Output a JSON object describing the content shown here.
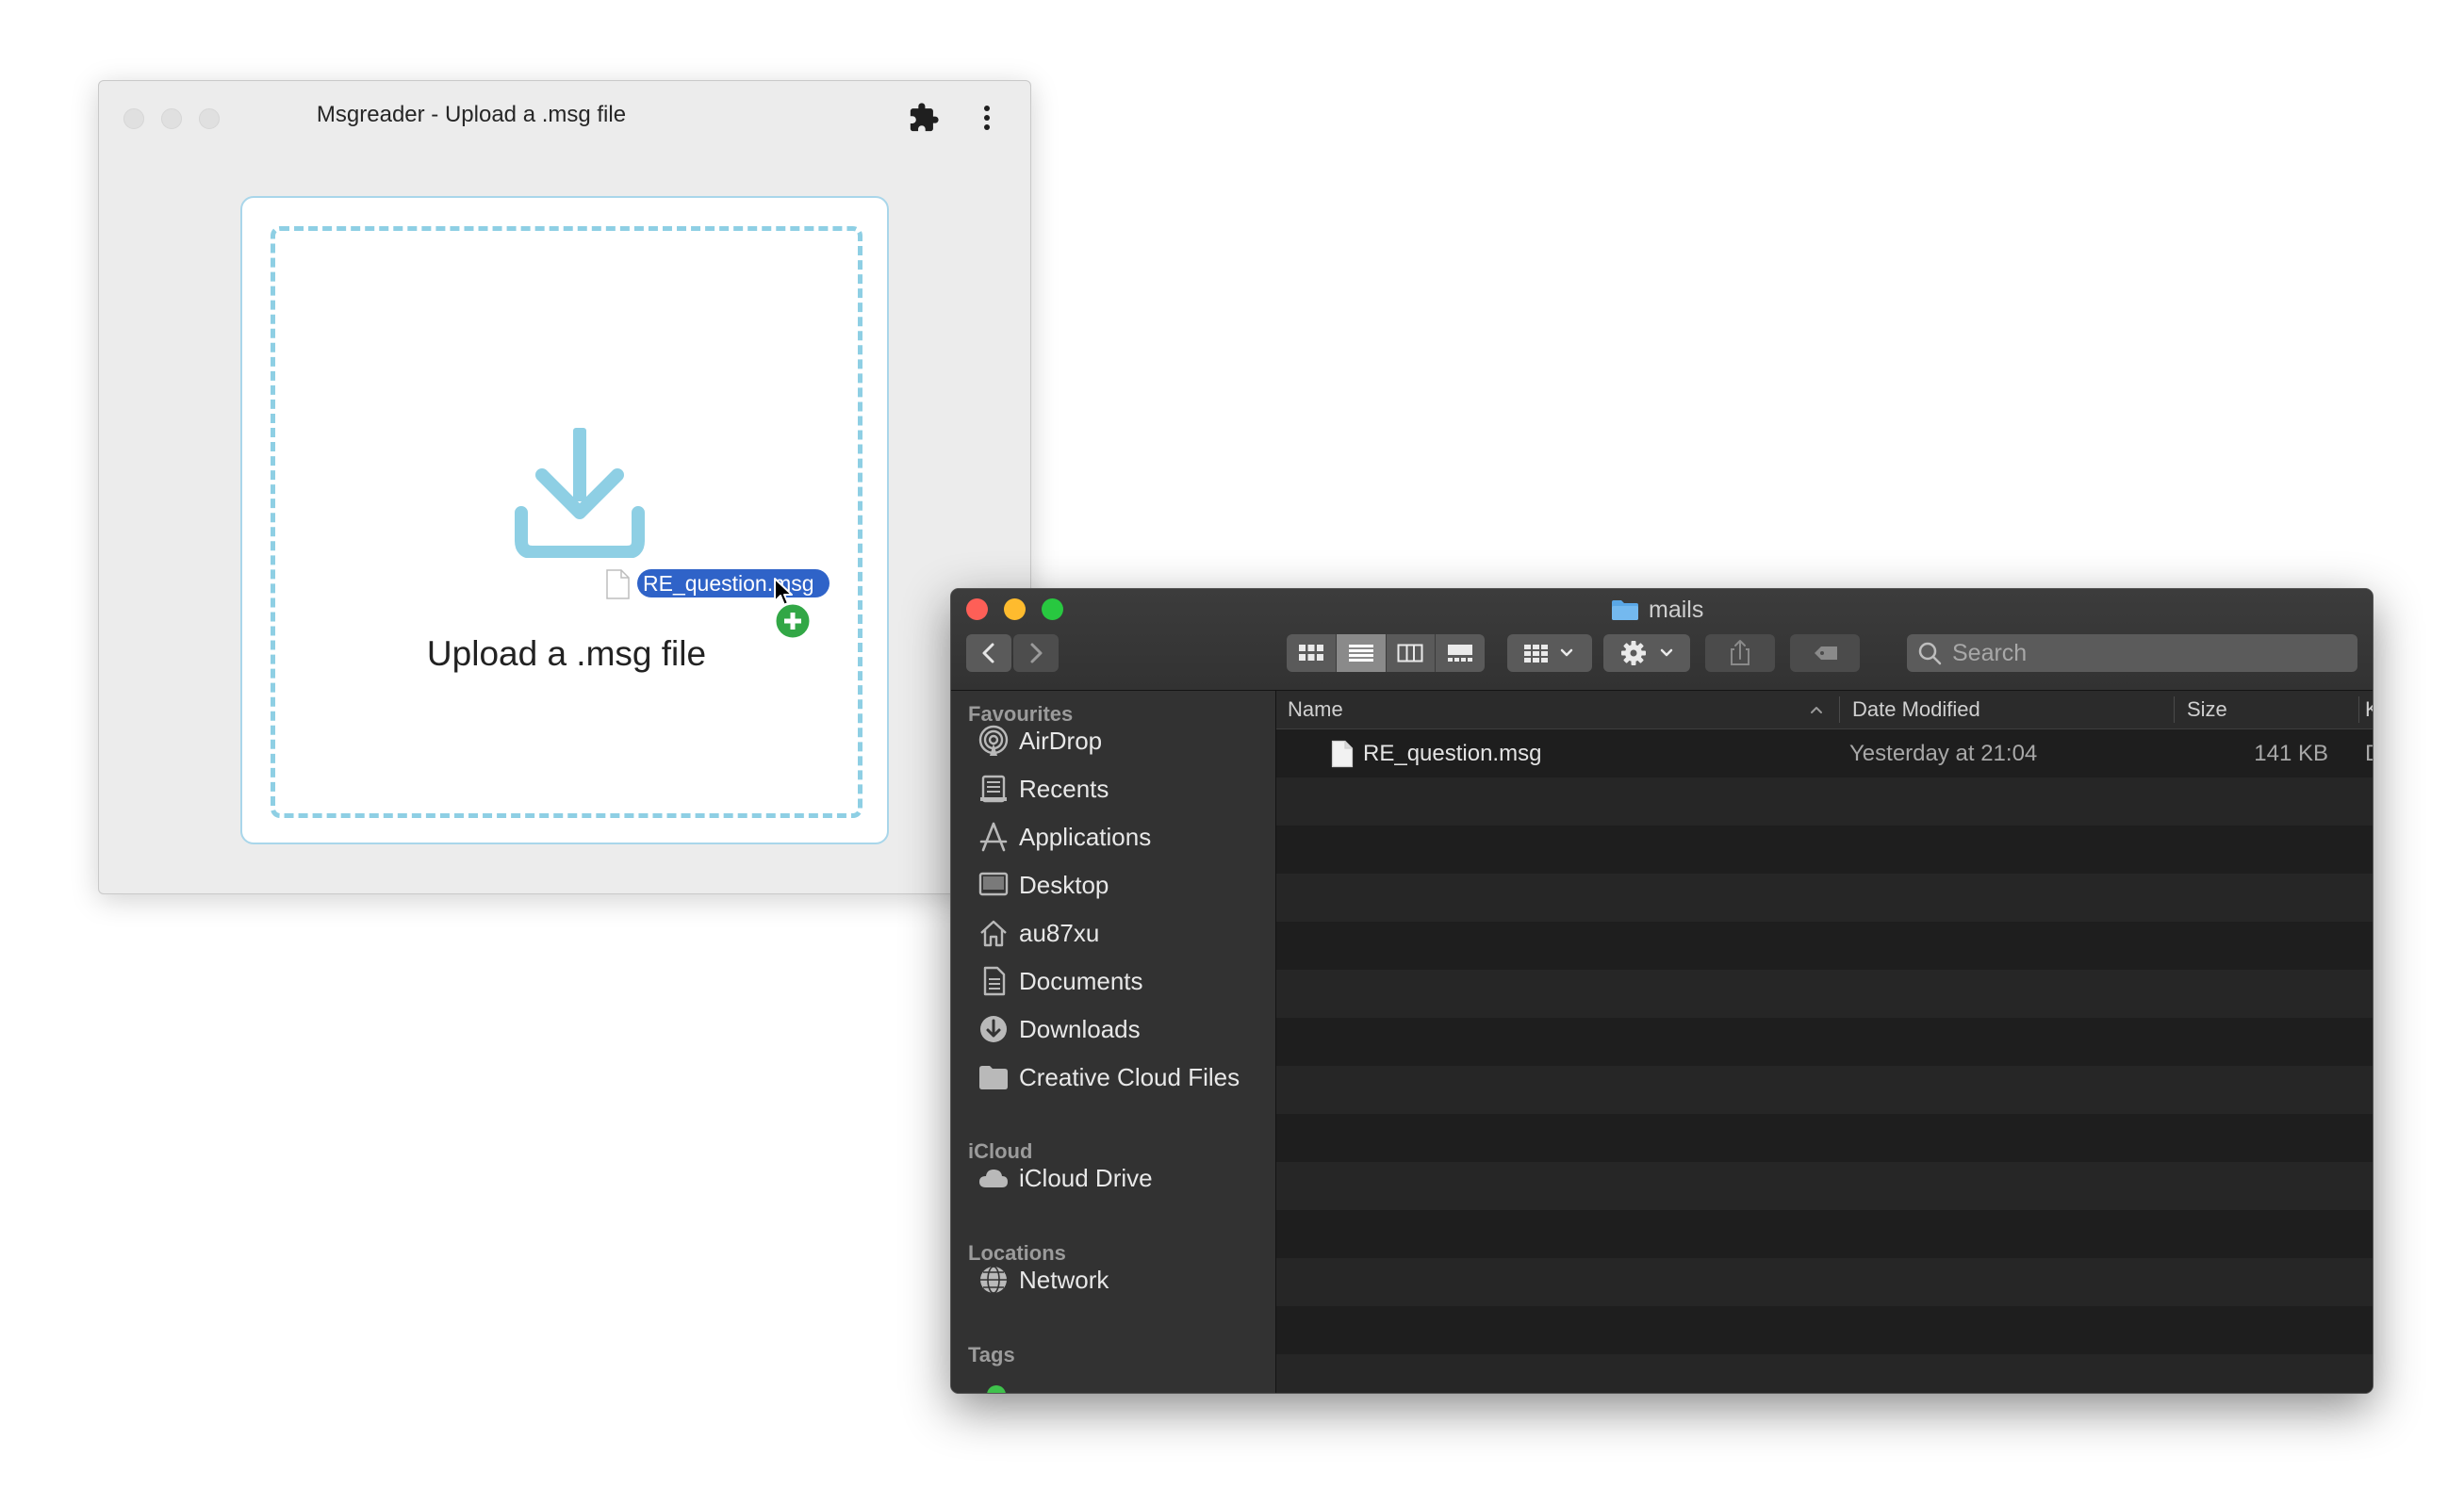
{
  "app_window": {
    "title": "Msgreader - Upload a .msg file",
    "upload_label": "Upload a .msg file",
    "accent_color": "#8ecfe4"
  },
  "drag": {
    "file_label": "RE_question.msg"
  },
  "finder": {
    "title": "mails",
    "search_placeholder": "Search",
    "sidebar": {
      "favourites_header": "Favourites",
      "favourites": [
        {
          "label": "AirDrop",
          "icon": "airdrop-icon"
        },
        {
          "label": "Recents",
          "icon": "recents-icon"
        },
        {
          "label": "Applications",
          "icon": "applications-icon"
        },
        {
          "label": "Desktop",
          "icon": "desktop-icon"
        },
        {
          "label": "au87xu",
          "icon": "home-icon"
        },
        {
          "label": "Documents",
          "icon": "documents-icon"
        },
        {
          "label": "Downloads",
          "icon": "downloads-icon"
        },
        {
          "label": "Creative Cloud Files",
          "icon": "folder-icon"
        }
      ],
      "icloud_header": "iCloud",
      "icloud": [
        {
          "label": "iCloud Drive",
          "icon": "cloud-icon"
        }
      ],
      "locations_header": "Locations",
      "locations": [
        {
          "label": "Network",
          "icon": "network-icon"
        }
      ],
      "tags_header": "Tags"
    },
    "columns": {
      "name": "Name",
      "date_modified": "Date Modified",
      "size": "Size",
      "kind_truncated": "K"
    },
    "files": [
      {
        "name": "RE_question.msg",
        "date_modified": "Yesterday at 21:04",
        "size": "141 KB",
        "kind_truncated": "D"
      }
    ]
  }
}
